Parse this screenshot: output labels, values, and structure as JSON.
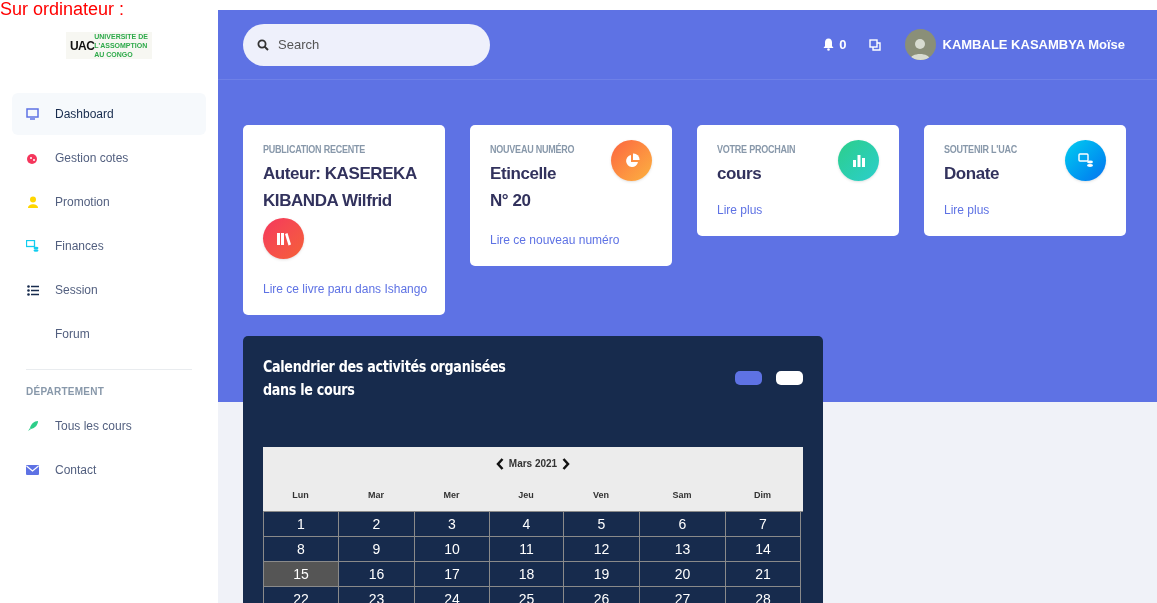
{
  "caption": "Sur ordinateur :",
  "sidebar": {
    "logo": {
      "mark": "UAC",
      "lines": [
        "UNIVERSITE DE",
        "L'ASSOMPTION",
        "AU CONGO"
      ]
    },
    "items": [
      {
        "label": "Dashboard",
        "selected": true
      },
      {
        "label": "Gestion cotes",
        "selected": false
      },
      {
        "label": "Promotion",
        "selected": false
      },
      {
        "label": "Finances",
        "selected": false
      },
      {
        "label": "Session",
        "selected": false
      },
      {
        "label": "Forum",
        "selected": false
      }
    ],
    "section_heading": "DÉPARTEMENT",
    "section_items": [
      {
        "label": "Tous les cours",
        "selected": false
      },
      {
        "label": "Contact",
        "selected": false
      }
    ]
  },
  "topbar": {
    "search": {
      "placeholder": "Search"
    },
    "notifications": "0",
    "user_name": "KAMBALE KASAMBYA Moïse"
  },
  "cards": [
    {
      "label": "PUBLICATION RECENTE",
      "title": [
        "Auteur: KASEREKA",
        "KIBANDA Wilfrid"
      ],
      "link": "Lire ce livre paru dans Ishango"
    },
    {
      "label": "NOUVEAU NUMÉRO",
      "title": [
        "Etincelle",
        "N° 20"
      ],
      "link": "Lire ce nouveau numéro"
    },
    {
      "label": "VOTRE PROCHAIN",
      "title": [
        "cours"
      ],
      "link": "Lire plus"
    },
    {
      "label": "SOUTENIR L'UAC",
      "title": [
        "Donate"
      ],
      "link": "Lire plus"
    }
  ],
  "calendar": {
    "title": "Calendrier des activités organisées dans le cours",
    "view_buttons": [
      {
        "selected": true
      },
      {
        "selected": false
      }
    ],
    "month": "Mars 2021",
    "weekdays": [
      "Lun",
      "Mar",
      "Mer",
      "Jeu",
      "Ven",
      "Sam",
      "Dim"
    ],
    "weeks": [
      [
        {
          "day": "1",
          "selected": false
        },
        {
          "day": "2",
          "selected": false
        },
        {
          "day": "3",
          "selected": false
        },
        {
          "day": "4",
          "selected": false
        },
        {
          "day": "5",
          "selected": false
        },
        {
          "day": "6",
          "selected": false
        },
        {
          "day": "7",
          "selected": false
        }
      ],
      [
        {
          "day": "8",
          "selected": false
        },
        {
          "day": "9",
          "selected": false
        },
        {
          "day": "10",
          "selected": false
        },
        {
          "day": "11",
          "selected": false
        },
        {
          "day": "12",
          "selected": false
        },
        {
          "day": "13",
          "selected": false
        },
        {
          "day": "14",
          "selected": false
        }
      ],
      [
        {
          "day": "15",
          "selected": true
        },
        {
          "day": "16",
          "selected": false
        },
        {
          "day": "17",
          "selected": false
        },
        {
          "day": "18",
          "selected": false
        },
        {
          "day": "19",
          "selected": false
        },
        {
          "day": "20",
          "selected": false
        },
        {
          "day": "21",
          "selected": false
        }
      ],
      [
        {
          "day": "22",
          "selected": false
        },
        {
          "day": "23",
          "selected": false
        },
        {
          "day": "24",
          "selected": false
        },
        {
          "day": "25",
          "selected": false
        },
        {
          "day": "26",
          "selected": false
        },
        {
          "day": "27",
          "selected": false
        },
        {
          "day": "28",
          "selected": false
        }
      ]
    ]
  }
}
